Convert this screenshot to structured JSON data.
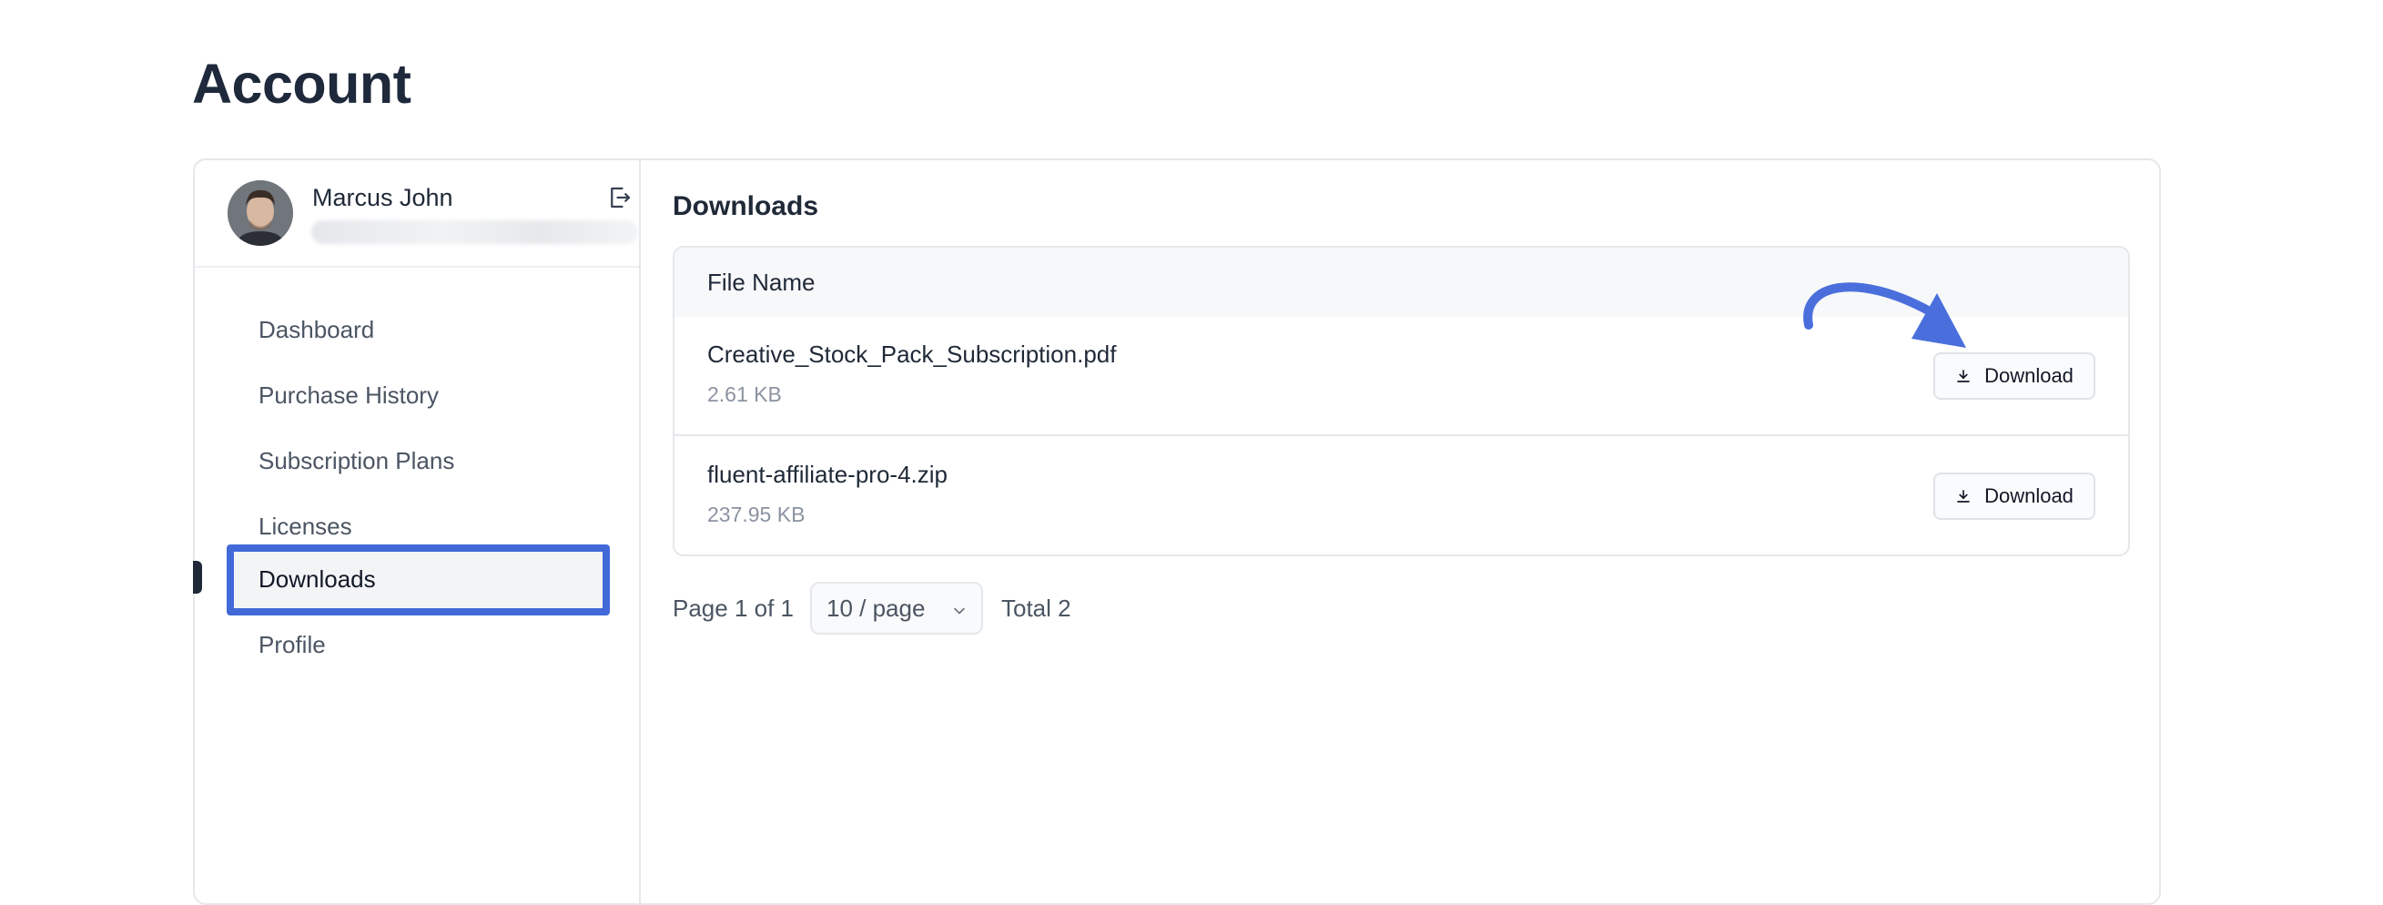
{
  "page": {
    "title": "Account"
  },
  "user": {
    "name": "Marcus John",
    "logout_icon": "logout-icon"
  },
  "sidebar": {
    "items": [
      {
        "label": "Dashboard"
      },
      {
        "label": "Purchase History"
      },
      {
        "label": "Subscription Plans"
      },
      {
        "label": "Licenses"
      },
      {
        "label": "Downloads",
        "active": true
      },
      {
        "label": "Profile"
      }
    ]
  },
  "downloads": {
    "title": "Downloads",
    "column_header": "File Name",
    "files": [
      {
        "name": "Creative_Stock_Pack_Subscription.pdf",
        "size": "2.61 KB",
        "action": "Download"
      },
      {
        "name": "fluent-affiliate-pro-4.zip",
        "size": "237.95 KB",
        "action": "Download"
      }
    ]
  },
  "pagination": {
    "page_info": "Page 1 of 1",
    "per_page": "10 / page",
    "total": "Total 2"
  },
  "colors": {
    "highlight": "#4169d8",
    "annotation_arrow": "#4a6fdc"
  }
}
